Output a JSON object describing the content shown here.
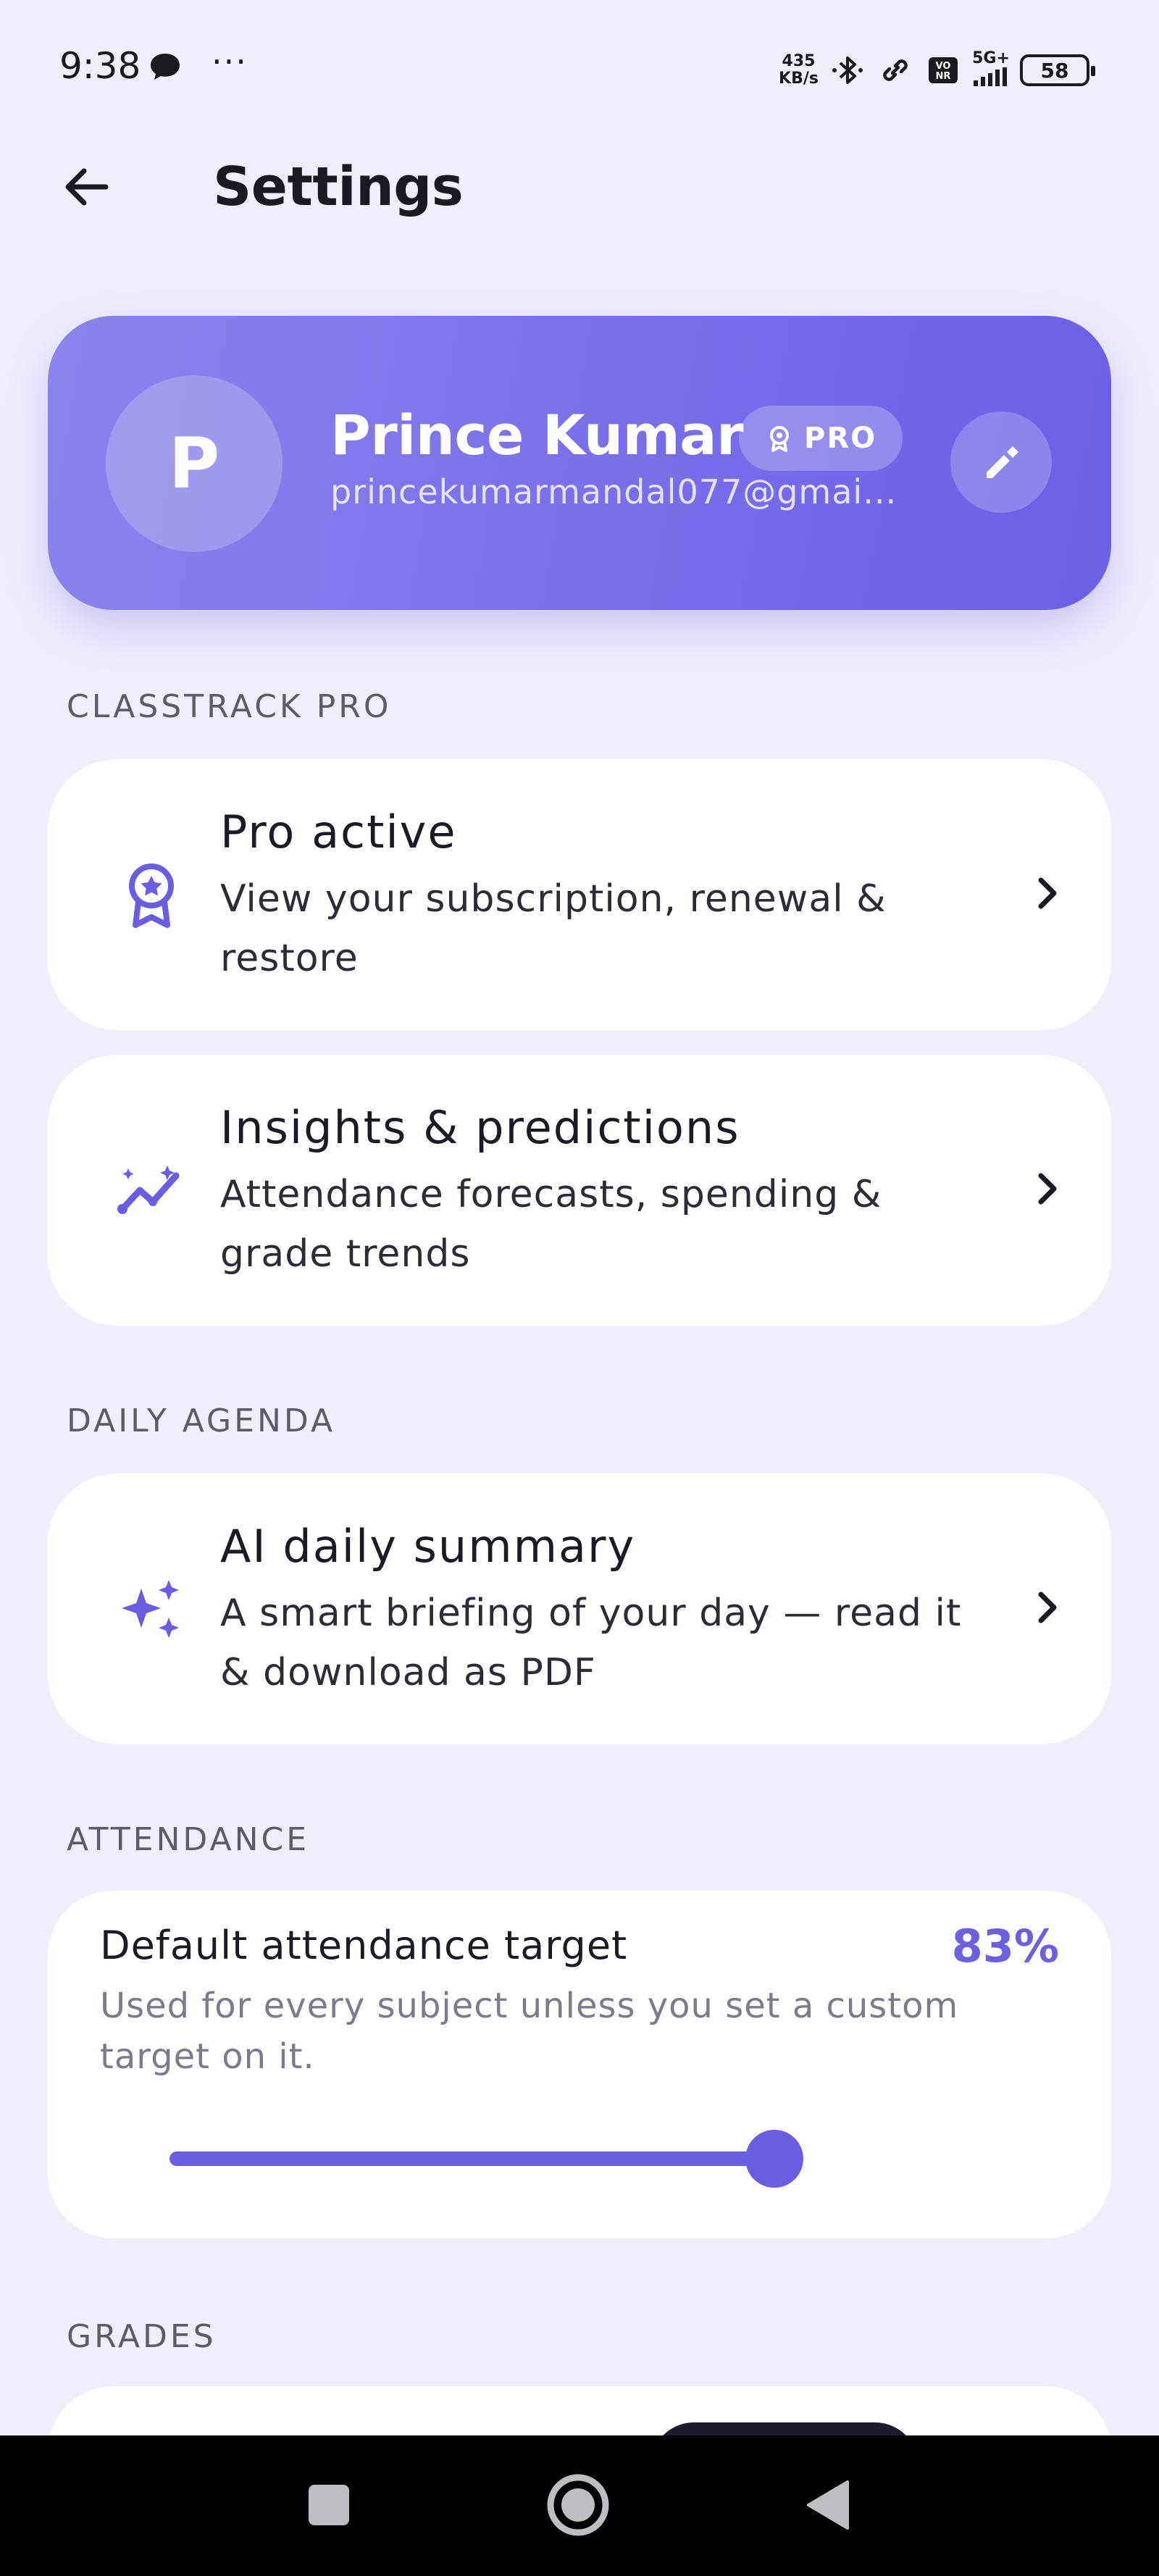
{
  "status_bar": {
    "time": "9:38",
    "dots": "···",
    "net_speed_value": "435",
    "net_speed_unit": "KB/s",
    "network_type": "5G+",
    "volte": "VO NR",
    "battery": "58"
  },
  "header": {
    "title": "Settings",
    "back_icon": "arrow-left-icon"
  },
  "profile": {
    "avatar_letter": "P",
    "name": "Prince Kumar",
    "badge": "PRO",
    "email": "princekumarmandal077@gmai...",
    "edit_icon": "pencil-icon"
  },
  "sections": {
    "classtrack_pro": "CLASSTRACK PRO",
    "daily_agenda": "DAILY AGENDA",
    "attendance": "ATTENDANCE",
    "grades": "GRADES"
  },
  "items": {
    "pro_active": {
      "icon": "award-badge-icon",
      "title": "Pro active",
      "description": "View your subscription, renewal & restore"
    },
    "insights": {
      "icon": "trend-sparkle-icon",
      "title": "Insights & predictions",
      "description": "Attendance forecasts, spending & grade trends"
    },
    "ai_summary": {
      "icon": "sparkles-icon",
      "title": "AI daily summary",
      "description": "A smart briefing of your day — read it & download as PDF"
    }
  },
  "attendance": {
    "title": "Default attendance target",
    "value": "83%",
    "description": "Used for every subject unless you set a custom target on it.",
    "slider_fraction": 0.96
  },
  "colors": {
    "accent": "#6a5de4",
    "background": "#efeefb",
    "card_gradient_start": "#8b84ec",
    "card_gradient_end": "#6b5fe6"
  }
}
